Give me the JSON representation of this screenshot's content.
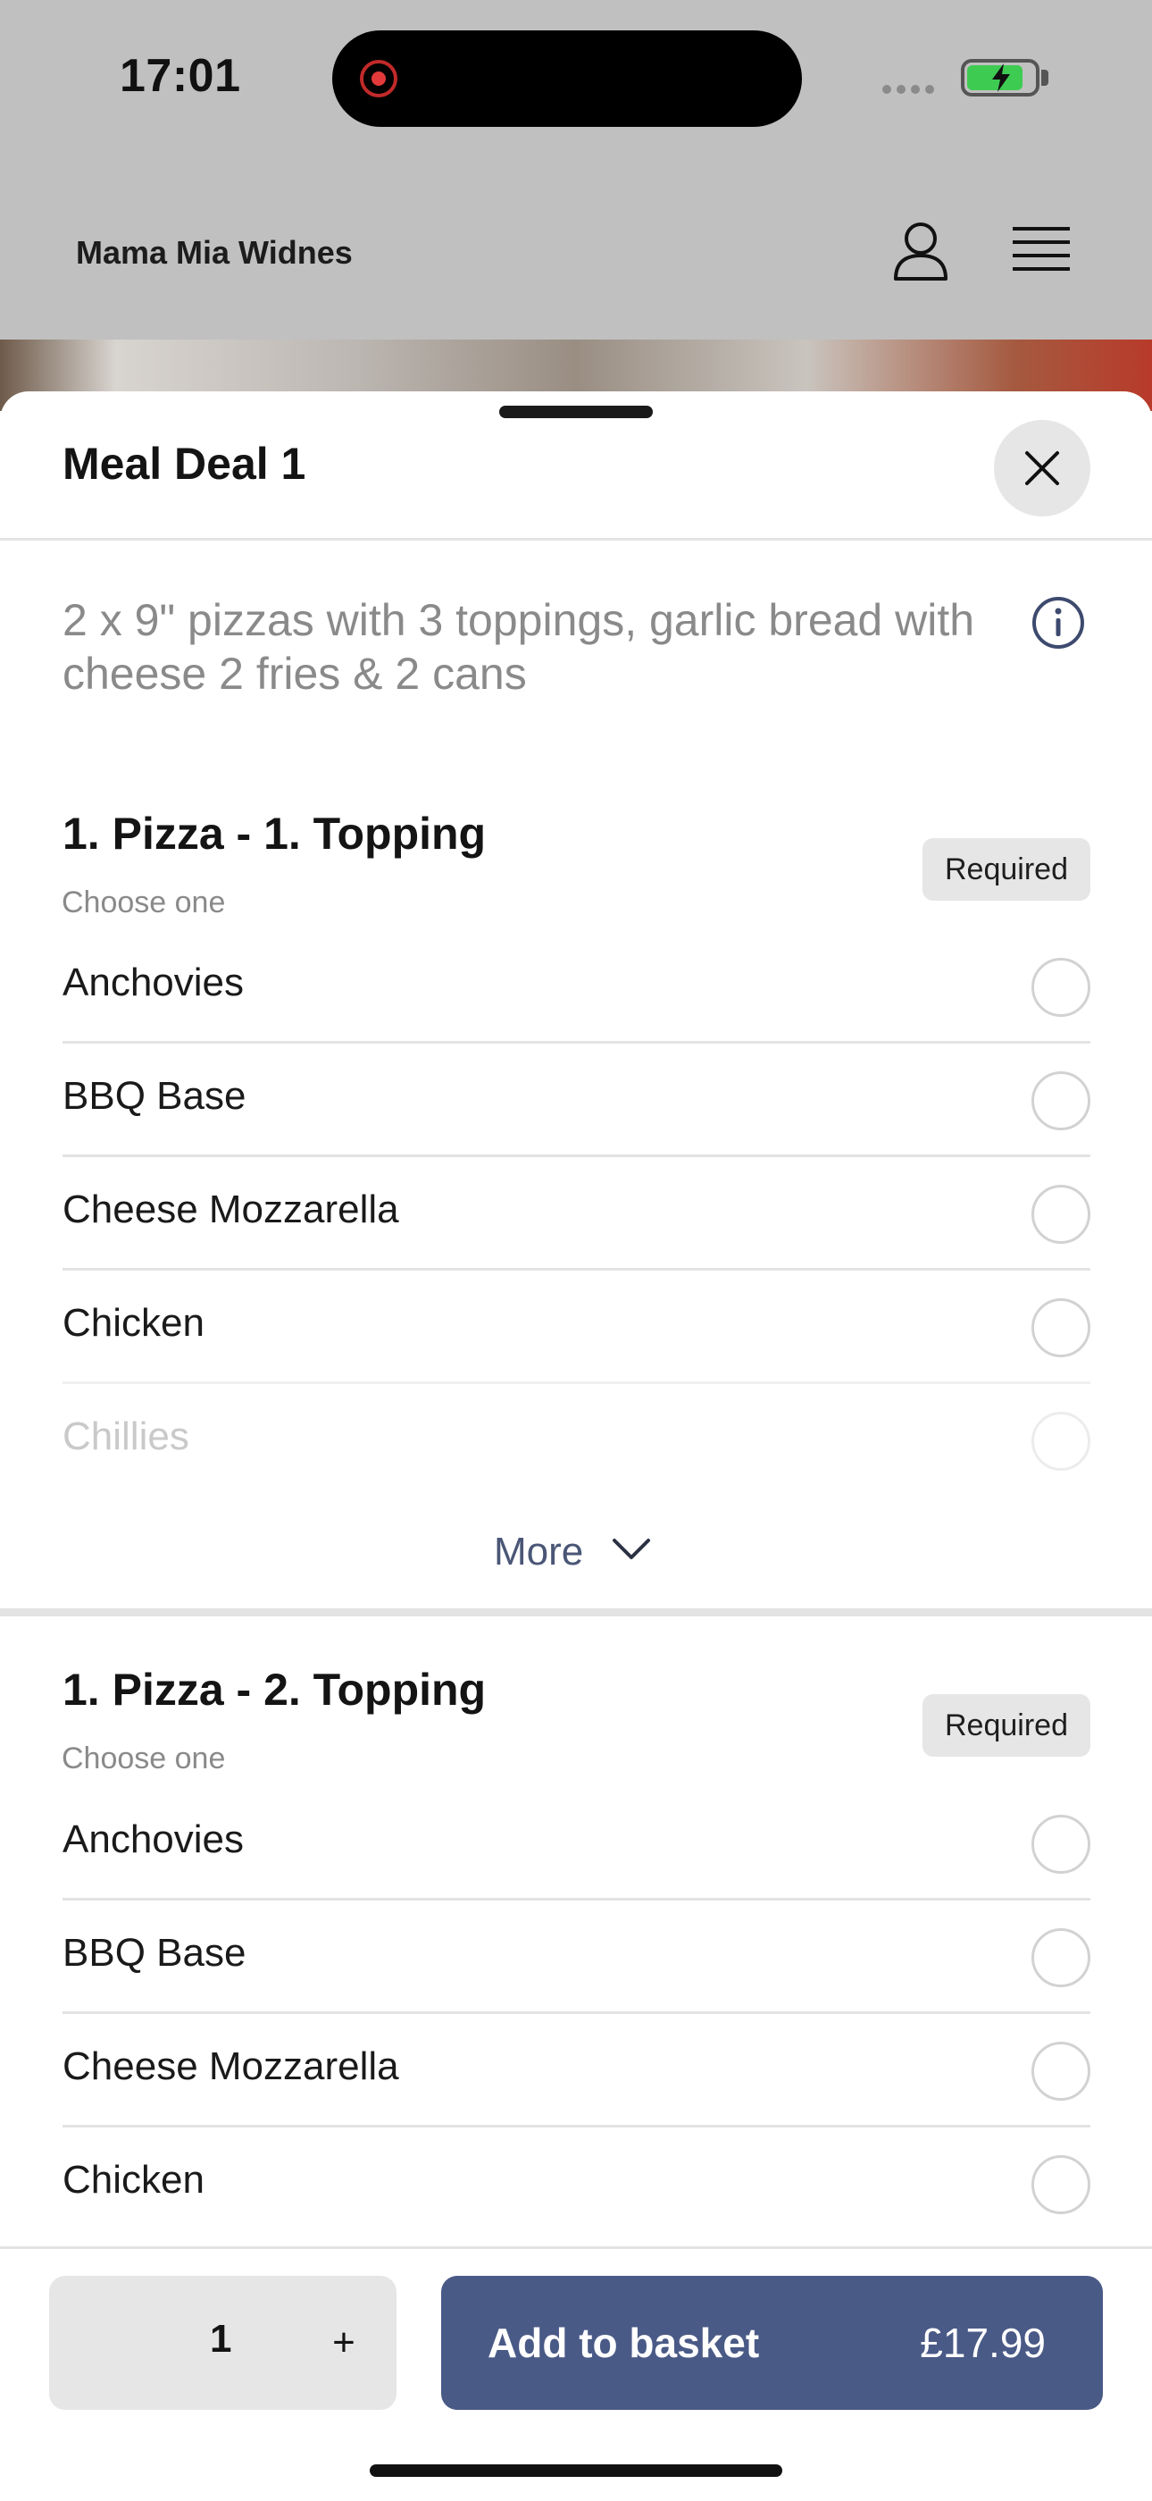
{
  "status_bar": {
    "time": "17:01"
  },
  "header": {
    "brand": "Mama Mia Widnes"
  },
  "sheet": {
    "title": "Meal Deal 1",
    "description": "2 x 9\" pizzas with 3 toppings, garlic bread with cheese 2 fries & 2 cans"
  },
  "sections": [
    {
      "title": "1. Pizza - 1. Topping",
      "subtitle": "Choose one",
      "badge": "Required",
      "options": [
        "Anchovies",
        "BBQ Base",
        "Cheese Mozzarella",
        "Chicken",
        "Chillies"
      ],
      "more_label": "More"
    },
    {
      "title": "1. Pizza - 2. Topping",
      "subtitle": "Choose one",
      "badge": "Required",
      "options": [
        "Anchovies",
        "BBQ Base",
        "Cheese Mozzarella",
        "Chicken"
      ]
    }
  ],
  "footer": {
    "quantity": "1",
    "plus": "+",
    "add_label": "Add to basket",
    "price": "£17.99"
  },
  "colors": {
    "accent": "#4a5a87",
    "more_link": "#4a5676",
    "muted_text": "#8a8a8a"
  }
}
